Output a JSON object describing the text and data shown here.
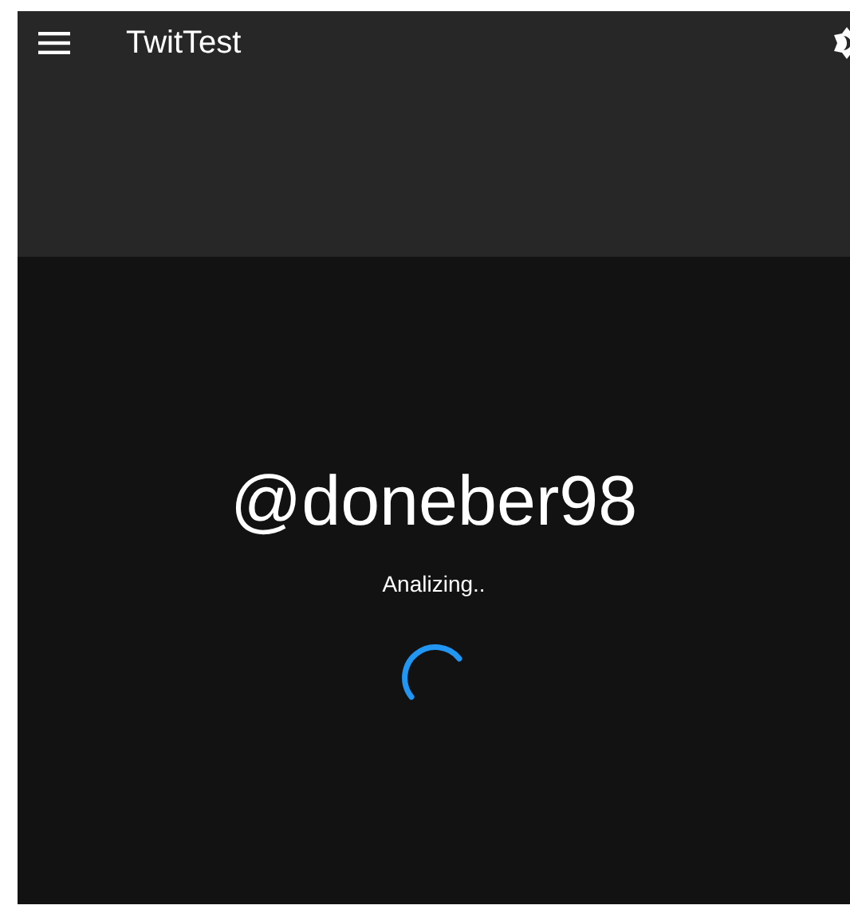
{
  "app_bar": {
    "title": "TwitTest"
  },
  "content": {
    "username": "@doneber98",
    "status": "Analizing.."
  }
}
